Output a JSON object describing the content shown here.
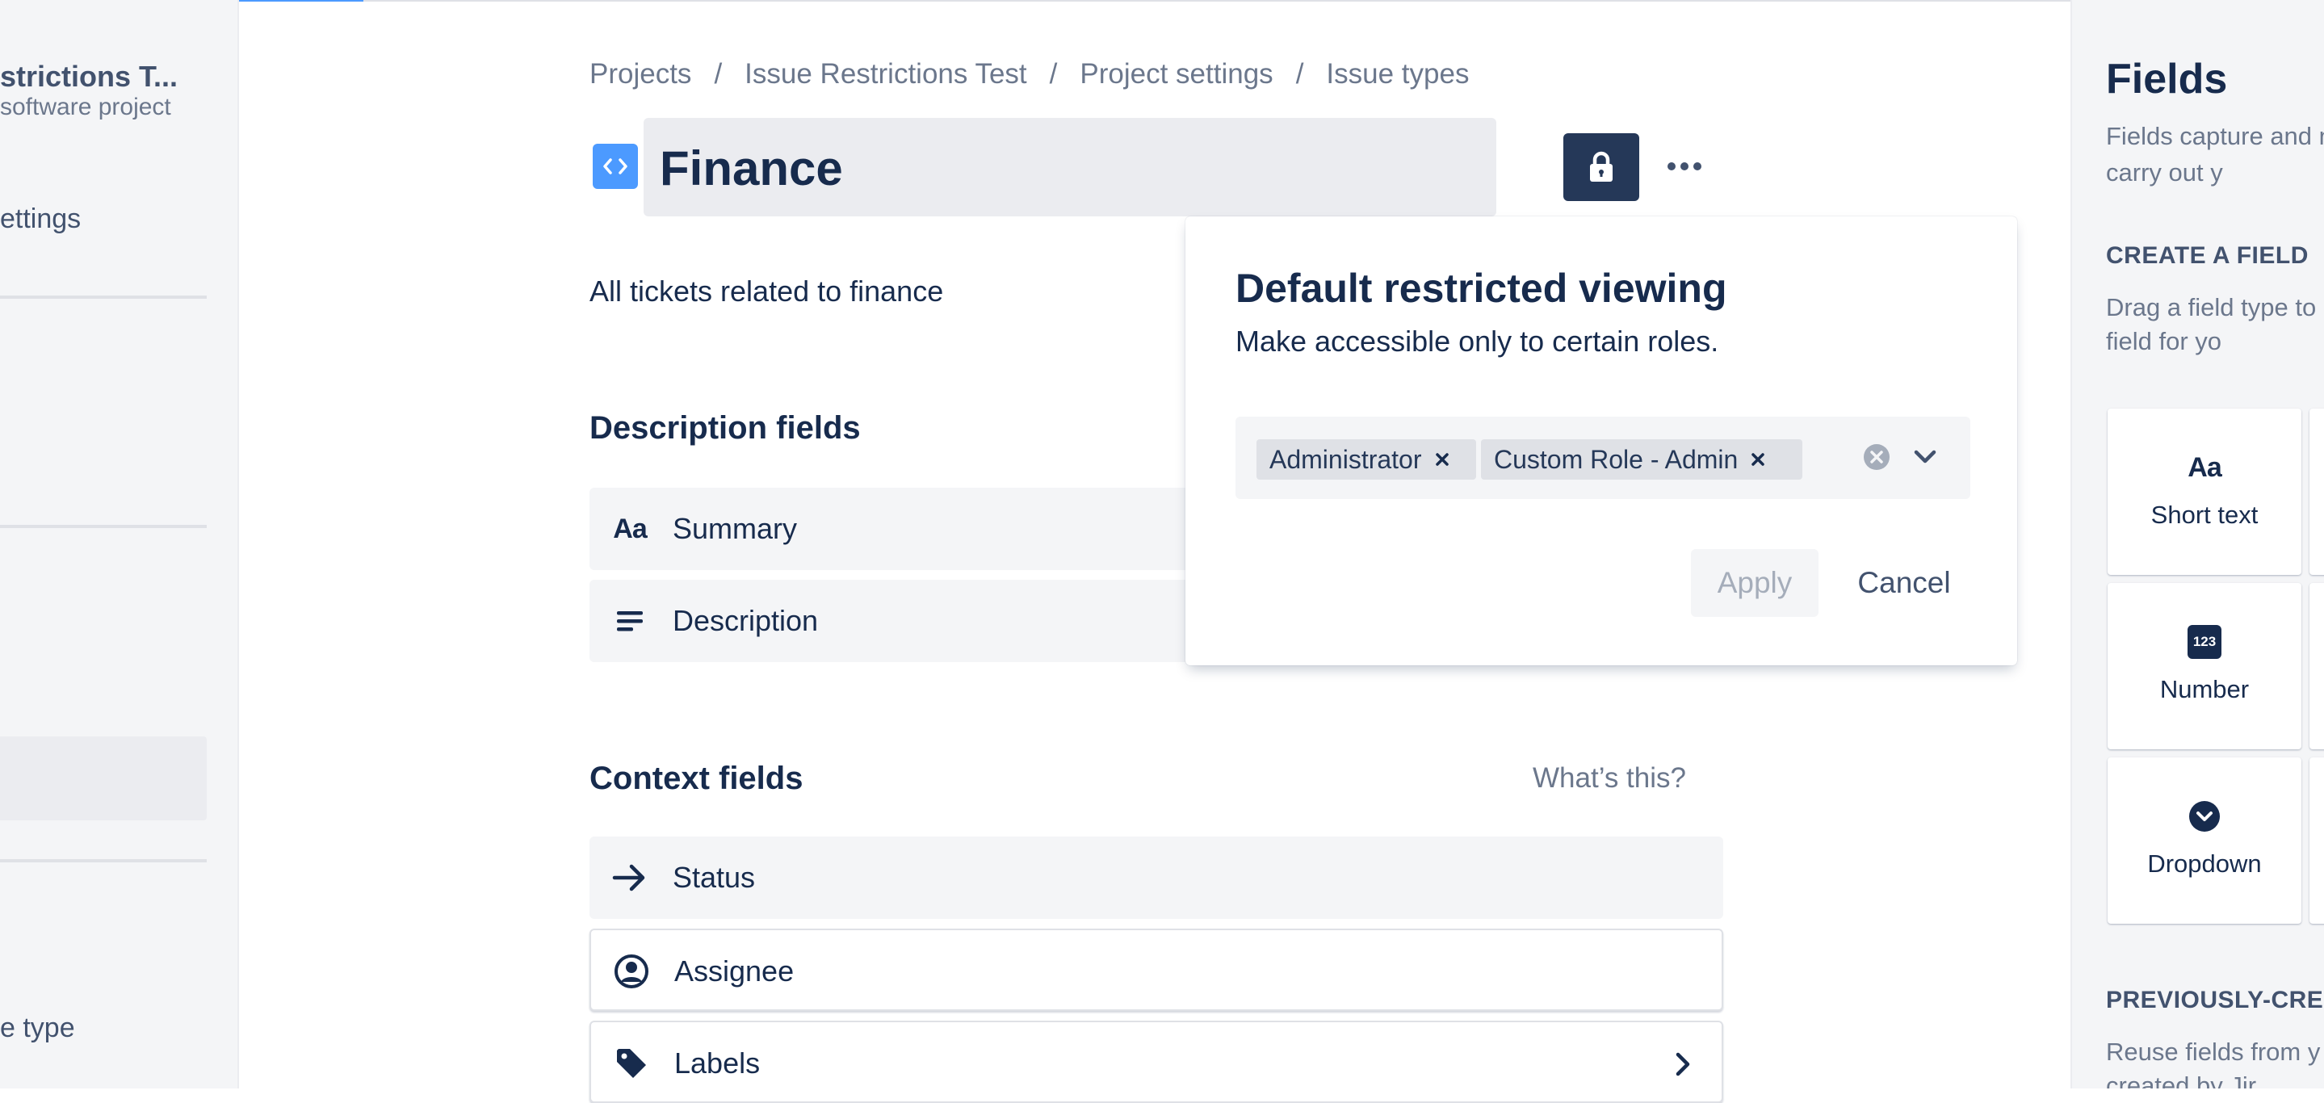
{
  "sidebar": {
    "project_name": "strictions T...",
    "project_type": "software project",
    "settings_label": "ettings",
    "bottom_item": "e type"
  },
  "breadcrumb": [
    "Projects",
    "Issue Restrictions Test",
    "Project settings",
    "Issue types"
  ],
  "issue_type": {
    "name": "Finance",
    "description": "All tickets related to finance"
  },
  "description_fields": {
    "heading": "Description fields",
    "items": [
      {
        "label": "Summary",
        "icon": "text-icon"
      },
      {
        "label": "Description",
        "icon": "paragraph-icon"
      }
    ]
  },
  "context_fields": {
    "heading": "Context fields",
    "help_link": "What’s this?",
    "items": [
      {
        "label": "Status",
        "icon": "arrow-right-icon"
      },
      {
        "label": "Assignee",
        "icon": "user-avatar-icon"
      },
      {
        "label": "Labels",
        "icon": "tag-icon"
      }
    ]
  },
  "popup": {
    "title": "Default restricted viewing",
    "subtitle": "Make accessible only to certain roles.",
    "selected_roles": [
      "Administrator",
      "Custom Role - Admin"
    ],
    "apply_label": "Apply",
    "cancel_label": "Cancel"
  },
  "right_panel": {
    "title": "Fields",
    "description": "Fields capture and need to carry out y",
    "create_heading": "CREATE A FIELD",
    "create_description": "Drag a field type to custom field for yo",
    "field_types": [
      {
        "label": "Short text",
        "icon": "text-icon"
      },
      {
        "label": "Number",
        "icon": "number-icon",
        "badge": "123"
      },
      {
        "label": "Dropdown",
        "icon": "dropdown-icon"
      }
    ],
    "previous_heading": "PREVIOUSLY-CRE",
    "previous_description": "Reuse fields from y field created by Jir"
  },
  "colors": {
    "accent": "#4c9aff",
    "lock_button": "#253858",
    "text": "#172b4d"
  }
}
